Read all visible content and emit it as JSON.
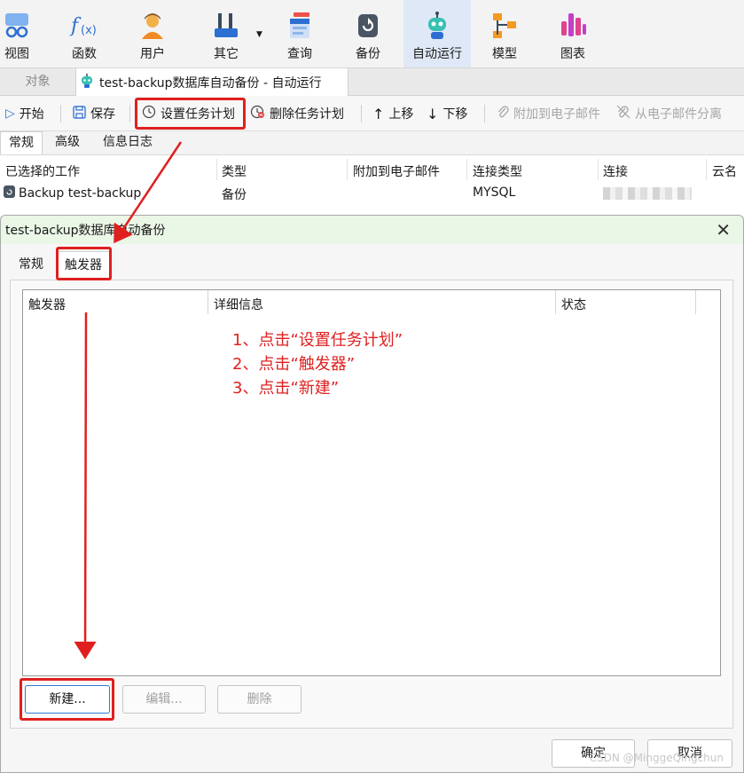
{
  "ribbon": {
    "items": [
      {
        "label": "视图",
        "icon": "view-icon"
      },
      {
        "label": "函数",
        "icon": "function-icon"
      },
      {
        "label": "用户",
        "icon": "user-icon"
      },
      {
        "label": "其它",
        "icon": "tools-icon"
      },
      {
        "label": "查询",
        "icon": "query-icon"
      },
      {
        "label": "备份",
        "icon": "backup-icon"
      },
      {
        "label": "自动运行",
        "icon": "robot-icon",
        "active": true
      },
      {
        "label": "模型",
        "icon": "model-icon"
      },
      {
        "label": "图表",
        "icon": "chart-icon"
      }
    ]
  },
  "doc_tabs": {
    "objects_label": "对象",
    "current_label": "test-backup数据库自动备份 - 自动运行"
  },
  "commands": {
    "start": "开始",
    "save": "保存",
    "set_schedule": "设置任务计划",
    "delete_schedule": "删除任务计划",
    "move_up": "上移",
    "move_down": "下移",
    "attach_email": "附加到电子邮件",
    "detach_email": "从电子邮件分离"
  },
  "sub_tabs": [
    "常规",
    "高级",
    "信息日志"
  ],
  "job_list": {
    "headers": [
      "已选择的工作",
      "类型",
      "附加到电子邮件",
      "连接类型",
      "连接",
      "云名"
    ],
    "rows": [
      {
        "job": "Backup test-backup",
        "type": "备份",
        "attach": "",
        "conn_type": "MYSQL"
      }
    ]
  },
  "dialog": {
    "title": "test-backup数据库自动备份",
    "tabs": [
      "常规",
      "触发器"
    ],
    "active_tab": "触发器",
    "grid_headers": [
      "触发器",
      "详细信息",
      "状态"
    ],
    "annotations": [
      "1、点击“设置任务计划”",
      "2、点击“触发器”",
      "3、点击“新建”"
    ],
    "buttons": {
      "new": "新建...",
      "edit": "编辑...",
      "delete": "删除"
    },
    "ok": "确定",
    "cancel": "取消",
    "watermark": "CSDN @MinggeQingchun"
  },
  "colors": {
    "highlight": "#e01f1f",
    "dialog_title_bg": "#eaf6e6",
    "active_ribbon_bg": "#dfe8f6",
    "primary_border": "#2f7ad8"
  }
}
